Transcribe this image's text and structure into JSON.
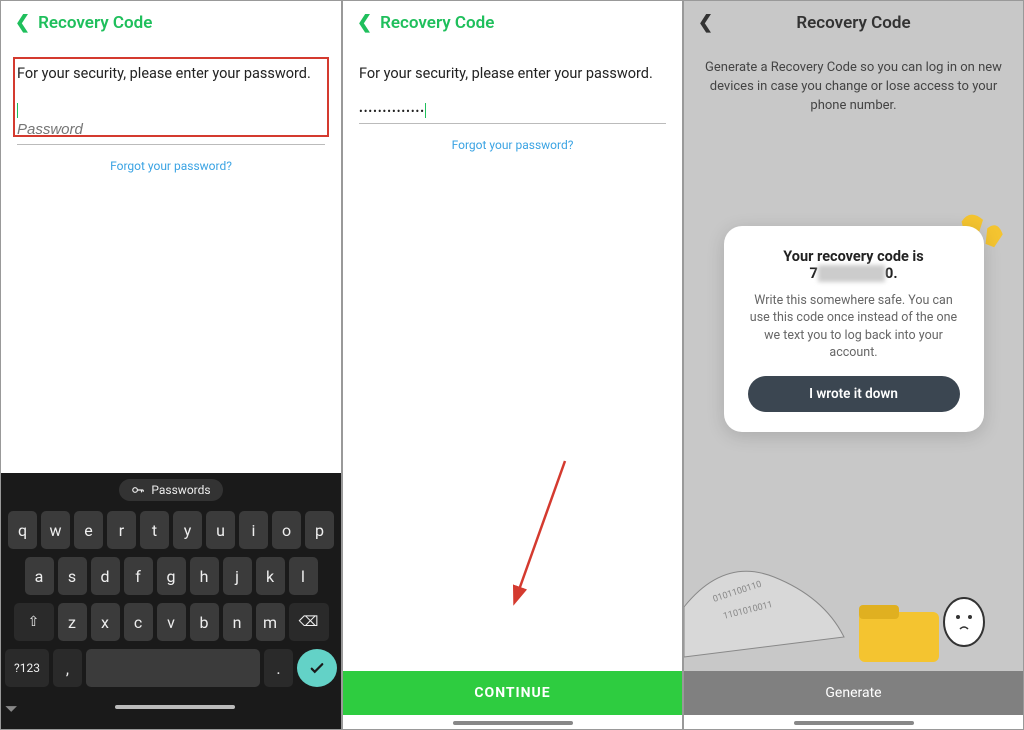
{
  "screen1": {
    "header_title": "Recovery Code",
    "prompt": "For your security, please enter your password.",
    "password_placeholder": "Password",
    "forgot_link": "Forgot your password?",
    "keyboard": {
      "suggestion": "Passwords",
      "row1": [
        "q",
        "w",
        "e",
        "r",
        "t",
        "y",
        "u",
        "i",
        "o",
        "p"
      ],
      "row2": [
        "a",
        "s",
        "d",
        "f",
        "g",
        "h",
        "j",
        "k",
        "l"
      ],
      "shift": "⇧",
      "row3": [
        "z",
        "x",
        "c",
        "v",
        "b",
        "n",
        "m"
      ],
      "backspace": "⌫",
      "numkey": "?123",
      "comma": ",",
      "period": "."
    }
  },
  "screen2": {
    "header_title": "Recovery Code",
    "prompt": "For your security, please enter your password.",
    "password_value": "••••••••••••••",
    "forgot_link": "Forgot your password?",
    "continue_label": "CONTINUE"
  },
  "screen3": {
    "header_title": "Recovery Code",
    "description": "Generate a Recovery Code so you can log in on new devices in case you change or lose access to your phone number.",
    "modal": {
      "title": "Your recovery code is",
      "code_prefix": "7",
      "code_suffix": "0.",
      "body": "Write this somewhere safe. You can use this code once instead of the one we text you to log back into your account.",
      "button": "I wrote it down"
    },
    "generate_label": "Generate"
  }
}
